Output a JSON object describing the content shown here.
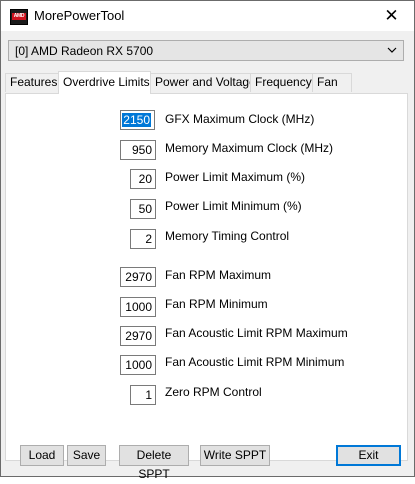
{
  "window": {
    "title": "MorePowerTool",
    "icon_name": "amd-logo-icon",
    "icon_text": "AMD",
    "close_glyph": "✕"
  },
  "gpu_select": {
    "selected": "[0] AMD Radeon RX 5700"
  },
  "tabs": [
    {
      "label": "Features",
      "active": false
    },
    {
      "label": "Overdrive Limits",
      "active": true
    },
    {
      "label": "Power and Voltage",
      "active": false
    },
    {
      "label": "Frequency",
      "active": false
    },
    {
      "label": "Fan",
      "active": false
    }
  ],
  "fields": [
    {
      "label": "GFX Maximum Clock (MHz)",
      "value": "2150",
      "selected": true
    },
    {
      "label": "Memory Maximum Clock (MHz)",
      "value": "950"
    },
    {
      "label": "Power Limit Maximum (%)",
      "value": "20"
    },
    {
      "label": "Power Limit Minimum (%)",
      "value": "50"
    },
    {
      "label": "Memory Timing Control",
      "value": "2"
    },
    {
      "label": "Fan RPM Maximum",
      "value": "2970"
    },
    {
      "label": "Fan RPM Minimum",
      "value": "1000"
    },
    {
      "label": "Fan Acoustic Limit RPM Maximum",
      "value": "2970"
    },
    {
      "label": "Fan Acoustic Limit RPM Minimum",
      "value": "1000"
    },
    {
      "label": "Zero RPM Control",
      "value": "1"
    }
  ],
  "buttons": {
    "load": "Load",
    "save": "Save",
    "delete_sppt": "Delete SPPT",
    "write_sppt": "Write SPPT",
    "exit": "Exit"
  },
  "colors": {
    "selection": "#0078d7",
    "amd_red": "#d0141f"
  }
}
